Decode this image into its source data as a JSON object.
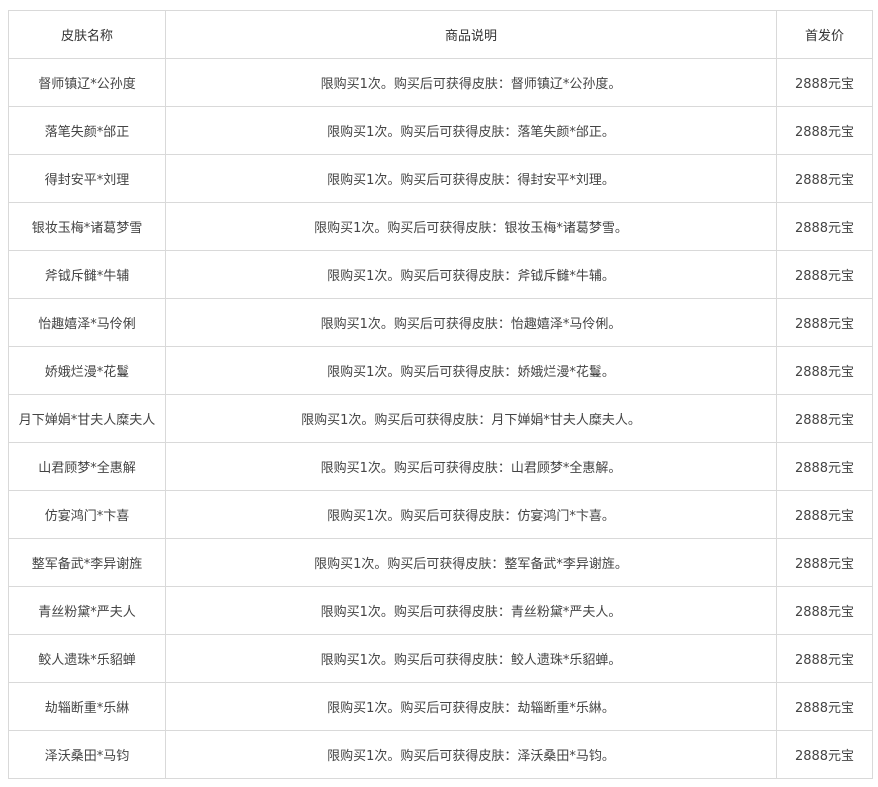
{
  "table": {
    "headers": [
      "皮肤名称",
      "商品说明",
      "首发价"
    ],
    "rows": [
      {
        "name": "督师镇辽*公孙度",
        "desc": "限购买1次。购买后可获得皮肤：督师镇辽*公孙度。",
        "price": "2888元宝"
      },
      {
        "name": "落笔失颜*邰正",
        "desc": "限购买1次。购买后可获得皮肤：落笔失颜*邰正。",
        "price": "2888元宝"
      },
      {
        "name": "得封安平*刘理",
        "desc": "限购买1次。购买后可获得皮肤：得封安平*刘理。",
        "price": "2888元宝"
      },
      {
        "name": "银妆玉梅*诸葛梦雪",
        "desc": "限购买1次。购买后可获得皮肤：银妆玉梅*诸葛梦雪。",
        "price": "2888元宝"
      },
      {
        "name": "斧钺斥雠*牛辅",
        "desc": "限购买1次。购买后可获得皮肤：斧钺斥雠*牛辅。",
        "price": "2888元宝"
      },
      {
        "name": "怡趣嬉泽*马伶俐",
        "desc": "限购买1次。购买后可获得皮肤：怡趣嬉泽*马伶俐。",
        "price": "2888元宝"
      },
      {
        "name": "娇娥烂漫*花鬘",
        "desc": "限购买1次。购买后可获得皮肤：娇娥烂漫*花鬘。",
        "price": "2888元宝"
      },
      {
        "name": "月下婵娟*甘夫人糜夫人",
        "desc": "限购买1次。购买后可获得皮肤：月下婵娟*甘夫人糜夫人。",
        "price": "2888元宝"
      },
      {
        "name": "山君顾梦*全惠解",
        "desc": "限购买1次。购买后可获得皮肤：山君顾梦*全惠解。",
        "price": "2888元宝"
      },
      {
        "name": "仿宴鸿门*卞喜",
        "desc": "限购买1次。购买后可获得皮肤：仿宴鸿门*卞喜。",
        "price": "2888元宝"
      },
      {
        "name": "整军备武*李异谢旌",
        "desc": "限购买1次。购买后可获得皮肤：整军备武*李异谢旌。",
        "price": "2888元宝"
      },
      {
        "name": "青丝粉黛*严夫人",
        "desc": "限购买1次。购买后可获得皮肤：青丝粉黛*严夫人。",
        "price": "2888元宝"
      },
      {
        "name": "鲛人遗珠*乐貂蝉",
        "desc": "限购买1次。购买后可获得皮肤：鲛人遗珠*乐貂蝉。",
        "price": "2888元宝"
      },
      {
        "name": "劫辎断重*乐綝",
        "desc": "限购买1次。购买后可获得皮肤：劫辎断重*乐綝。",
        "price": "2888元宝"
      },
      {
        "name": "泽沃桑田*马钧",
        "desc": "限购买1次。购买后可获得皮肤：泽沃桑田*马钧。",
        "price": "2888元宝"
      }
    ]
  }
}
